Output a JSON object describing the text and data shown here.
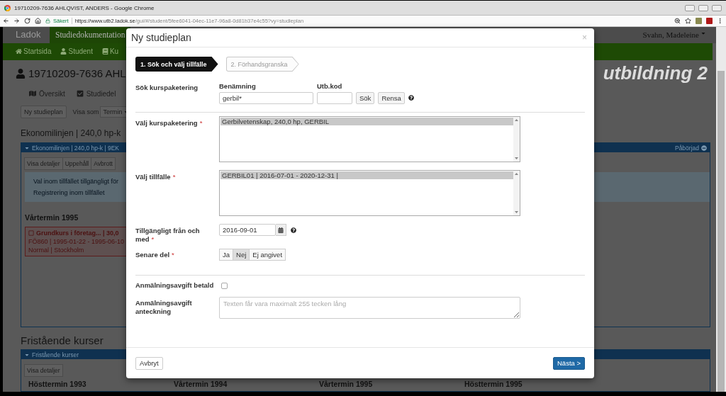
{
  "browser": {
    "title": "19710209-7636 AHLQVIST, ANDERS - Google Chrome",
    "security_label": "Säkert",
    "url_host": "https://www.utb2.ladok.se",
    "url_path": "/gui/#/student/5fee6041-04ec-11e7-96a8-0d81b37e4c55?vy=studieplan"
  },
  "app": {
    "logo": "Ladok",
    "nav_tab": "Studiedokumentation",
    "user": "Svahn, Madeleine",
    "brand": "utbildning 2",
    "menu": [
      {
        "label": "Startsida"
      },
      {
        "label": "Student"
      },
      {
        "label": "Ku"
      }
    ]
  },
  "student": {
    "heading": "19710209-7636 AHL",
    "tabs": [
      {
        "label": "Översikt"
      },
      {
        "label": "Studiedel"
      }
    ],
    "toolbar": {
      "button": "Ny studieplan",
      "view_label": "Visa som",
      "view_value": "Termin"
    },
    "program_heading": "Ekonomilinjen | 240,0 hp-k",
    "program_panel": {
      "title": "Ekonomilinjen | 240,0 hp-k | 9EK",
      "status": "Påbörjad",
      "actions": [
        "Visa detaljer",
        "Uppehåll",
        "Avbrott"
      ],
      "info_lines": [
        "Val inom tillfället tillgängligt för",
        "Registrering inom tillfället"
      ],
      "term": "Vårtermin 1995",
      "course": {
        "title": "Grundkurs i företag... | 30,0",
        "details": "FÖ860 | 1995-01-22 - 1995-06-10",
        "location": "Normal | Stockholm"
      }
    },
    "standalone_heading": "Fristående kurser",
    "standalone_panel": {
      "title": "Fristående kurser",
      "action": "Visa detaljer",
      "terms": [
        "Hösttermin 1993",
        "Vårtermin 1994",
        "Vårtermin 1995",
        "Hösttermin 1995"
      ]
    }
  },
  "dialog": {
    "title": "Ny studieplan",
    "close": "×",
    "steps": [
      {
        "label": "1. Sök och välj tillfälle",
        "selected": true
      },
      {
        "label": "2. Förhandsgranska",
        "selected": false
      }
    ],
    "search": {
      "label": "Sök kurspaketering",
      "name_label": "Benämning",
      "name_value": "gerbil*",
      "code_label": "Utb.kod",
      "buttons": [
        "Sök",
        "Rensa"
      ]
    },
    "package": {
      "label": "Välj kurspaketering",
      "required_mark": "*",
      "options": [
        {
          "label": "Gerbilvetenskap, 240,0 hp, GERBIL",
          "selected": true
        }
      ]
    },
    "occasion": {
      "label": "Välj tillfälle",
      "required_mark": "*",
      "options": [
        {
          "label": "GERBIL01 | 2016-07-01 - 2020-12-31 |",
          "selected": true
        }
      ]
    },
    "available_from": {
      "label": "Tillgängligt från och med",
      "required_mark": "*",
      "value": "2016-09-01"
    },
    "later_part": {
      "label": "Senare del",
      "required_mark": "*",
      "options": [
        {
          "label": "Ja",
          "selected": false
        },
        {
          "label": "Nej",
          "selected": true
        },
        {
          "label": "Ej angivet",
          "selected": false
        }
      ]
    },
    "fee_paid": {
      "label": "Anmälningsavgift betald",
      "checked": false
    },
    "fee_note": {
      "label": "Anmälningsavgift anteckning",
      "placeholder": "Texten får vara maximalt 255 tecken lång"
    },
    "footer": {
      "cancel": "Avbryt",
      "next": "Nästa >"
    }
  }
}
